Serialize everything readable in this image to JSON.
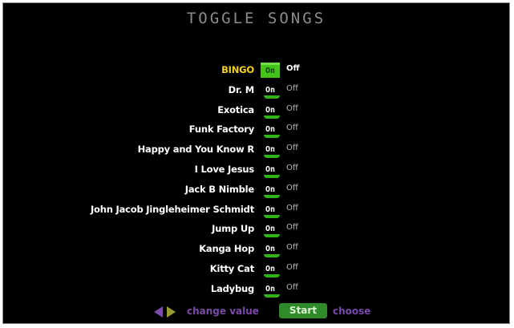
{
  "title": "TOGGLE SONGS",
  "colors": {
    "selected_song": "#f3d11b",
    "on_active": "#42c41c",
    "underline": "#2fb317",
    "hint_text": "#7a4aa8",
    "start_button": "#2f8a2a"
  },
  "on_label": "On",
  "off_label": "Off",
  "songs": [
    {
      "name": "BINGO",
      "value": "On",
      "selected": true
    },
    {
      "name": "Dr. M",
      "value": "On",
      "selected": false
    },
    {
      "name": "Exotica",
      "value": "On",
      "selected": false
    },
    {
      "name": "Funk Factory",
      "value": "On",
      "selected": false
    },
    {
      "name": "Happy and You Know R",
      "value": "On",
      "selected": false
    },
    {
      "name": "I Love Jesus",
      "value": "On",
      "selected": false
    },
    {
      "name": "Jack B Nimble",
      "value": "On",
      "selected": false
    },
    {
      "name": "John Jacob Jingleheimer Schmidt",
      "value": "On",
      "selected": false
    },
    {
      "name": "Jump Up",
      "value": "On",
      "selected": false
    },
    {
      "name": "Kanga Hop",
      "value": "On",
      "selected": false
    },
    {
      "name": "Kitty Cat",
      "value": "On",
      "selected": false
    },
    {
      "name": "Ladybug",
      "value": "On",
      "selected": false
    }
  ],
  "footer": {
    "change_value_label": "change value",
    "start_label": "Start",
    "choose_label": "choose",
    "arrows_icon": "left-right-arrows-icon"
  }
}
